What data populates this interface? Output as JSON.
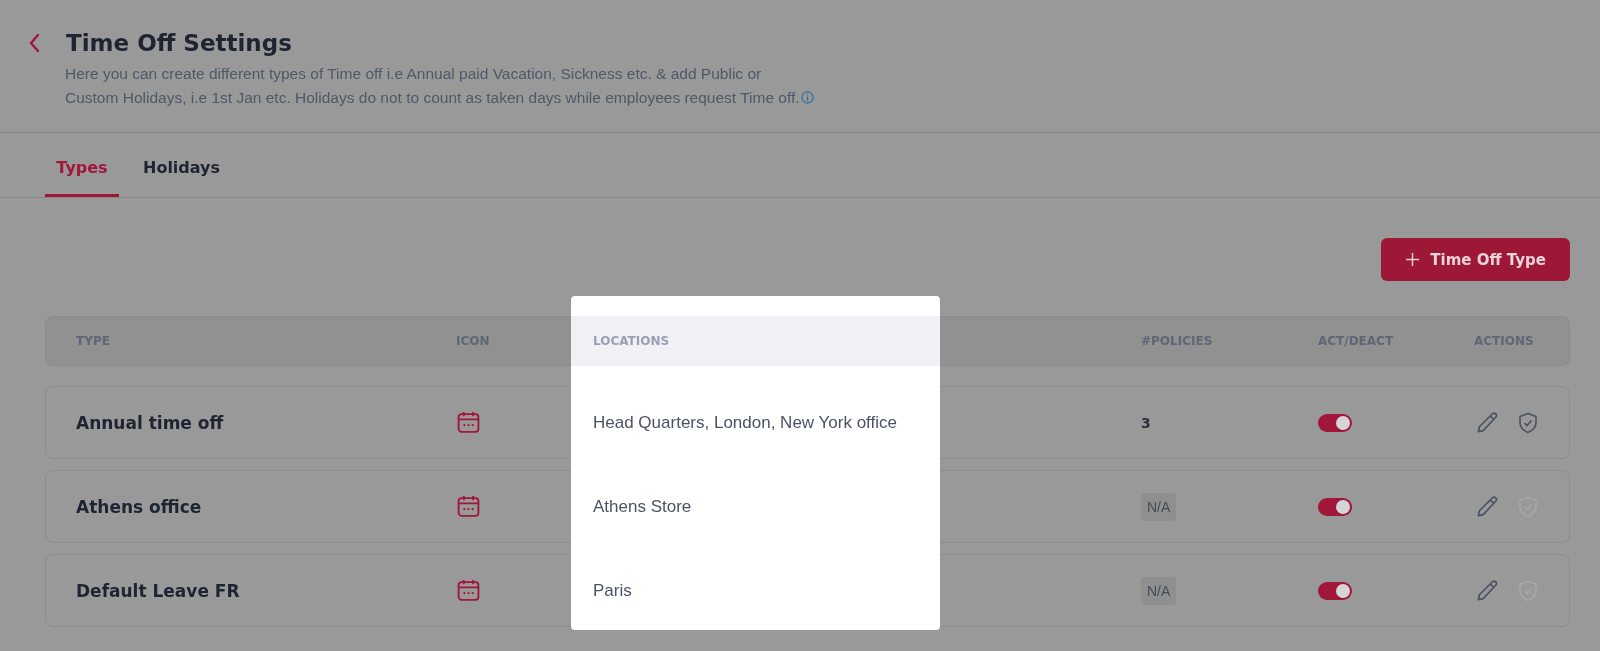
{
  "header": {
    "title": "Time Off Settings",
    "description_lines": [
      "Here you can create different types of Time off i.e Annual paid Vacation, Sickness etc. & add Public or",
      "Custom Holidays, i.e 1st Jan etc. Holidays do not to count as taken days while employees request Time off."
    ]
  },
  "tabs": [
    {
      "label": "Types",
      "selected": true
    },
    {
      "label": "Holidays",
      "selected": false
    }
  ],
  "add_button": {
    "label": "Time Off Type"
  },
  "table": {
    "columns": [
      "TYPE",
      "ICON",
      "LOCATIONS",
      "#POLICIES",
      "ACT/DEACT",
      "ACTIONS"
    ],
    "rows": [
      {
        "type": "Annual time off",
        "locations": "Head Quarters, London, New York office",
        "policies": "3",
        "kind": "count",
        "on": true,
        "shield_disabled": false
      },
      {
        "type": "Athens office",
        "locations": "Athens Store",
        "policies": "N/A",
        "kind": "badge",
        "on": true,
        "shield_disabled": true
      },
      {
        "type": "Default Leave FR",
        "locations": "Paris",
        "policies": "N/A",
        "kind": "badge",
        "on": true,
        "shield_disabled": true
      }
    ]
  }
}
